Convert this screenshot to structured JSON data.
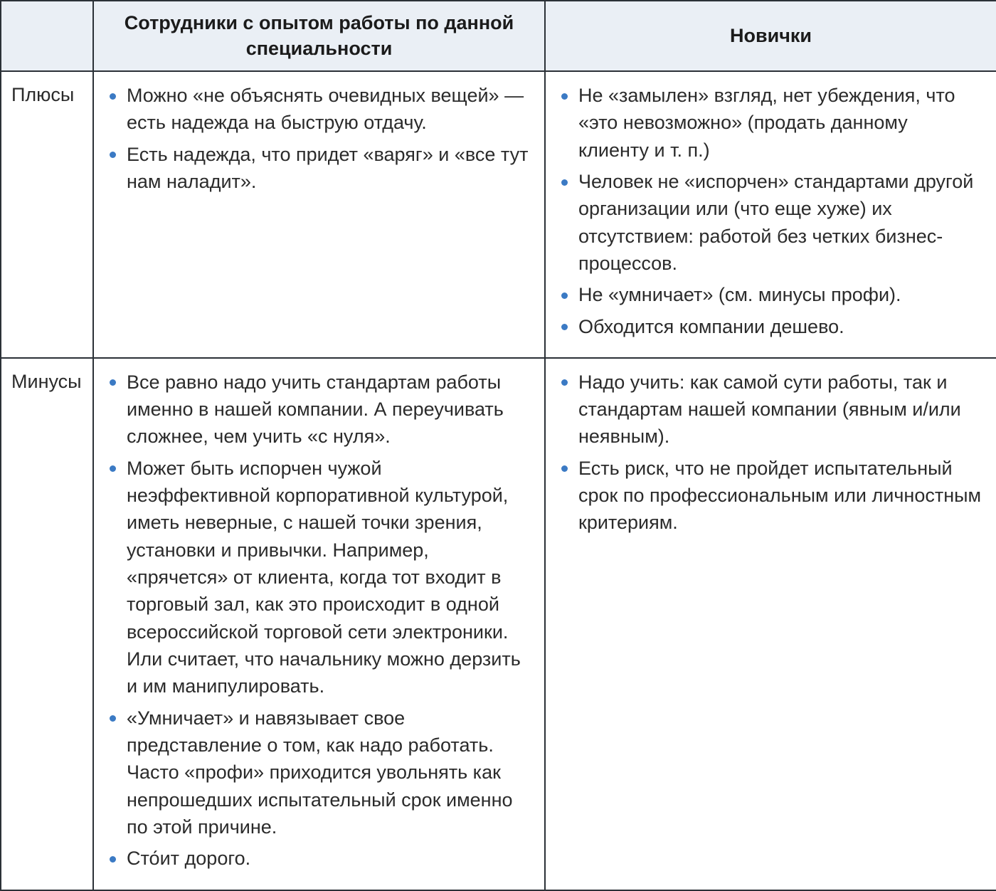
{
  "header": {
    "corner": "",
    "experienced": "Сотрудники с опытом работы по данной специальности",
    "newcomers": "Новички"
  },
  "rows": {
    "plus_label": "Плюсы",
    "minus_label": "Минусы"
  },
  "cells": {
    "plus_experienced": [
      "Можно «не объяснять очевидных вещей» — есть надежда на быструю отдачу.",
      "Есть надежда, что придет «варяг» и «все тут нам наладит»."
    ],
    "plus_newcomers": [
      "Не «замылен» взгляд, нет убеждения, что «это невозможно» (продать данному клиенту и т. п.)",
      "Человек не «испорчен» стандартами другой организации или (что еще хуже) их отсутствием: работой без четких бизнес-процессов.",
      "Не «умничает» (см. минусы профи).",
      "Обходится компании дешево."
    ],
    "minus_experienced": [
      "Все равно надо учить стандартам работы именно в нашей компании. А переучивать сложнее, чем учить «с нуля».",
      "Может быть испорчен чужой неэффективной корпоративной культурой, иметь неверные, с нашей точки зрения, установки и привычки. Например, «прячется» от клиента, когда тот входит в торговый зал, как это происходит в одной всероссийской торговой сети электроники. Или считает, что начальнику можно дерзить и им манипулировать.",
      "«Умничает» и навязывает свое представление о том, как надо работать. Часто «профи» приходится увольнять как непрошедших испытательный срок именно по этой причине.",
      "Сто́ит дорого."
    ],
    "minus_newcomers": [
      "Надо учить: как самой сути работы, так и стандартам нашей компании (явным и/или неявным).",
      "Есть риск, что не пройдет испытательный срок по профессиональным или личностным критериям."
    ]
  }
}
